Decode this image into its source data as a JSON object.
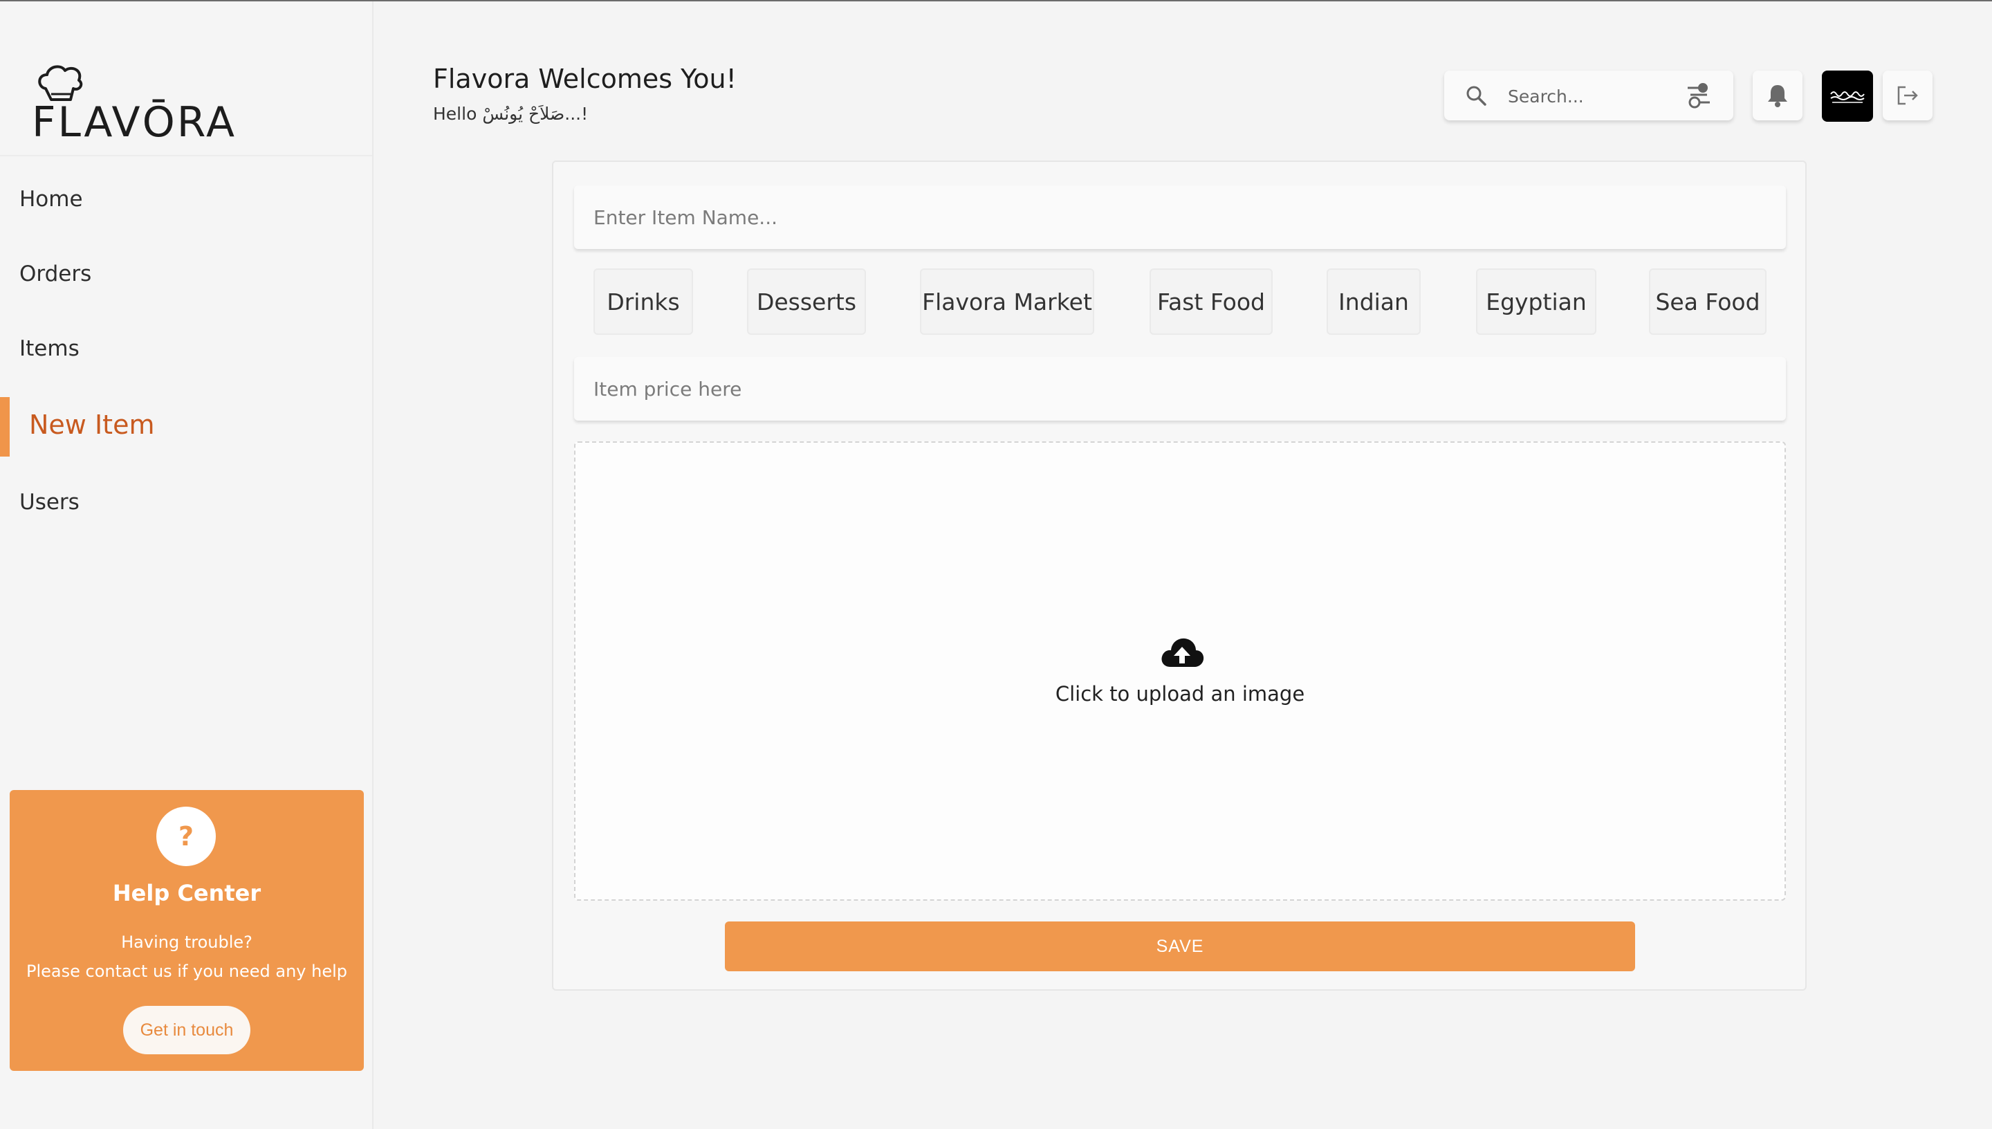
{
  "brand": {
    "logo_text": "FLAVŌRA"
  },
  "header": {
    "title": "Flavora Welcomes You!",
    "subtitle": "Hello صَلاَحْ يُونُسْ...!"
  },
  "search": {
    "placeholder": "Search..."
  },
  "sidebar": {
    "items": [
      {
        "label": "Home",
        "active": false
      },
      {
        "label": "Orders",
        "active": false
      },
      {
        "label": "Items",
        "active": false
      },
      {
        "label": "New Item",
        "active": true
      },
      {
        "label": "Users",
        "active": false
      }
    ]
  },
  "help": {
    "icon": "?",
    "title": "Help Center",
    "line1": "Having trouble?",
    "line2": "Please contact us if you need any help",
    "button": "Get in touch"
  },
  "form": {
    "name_placeholder": "Enter Item Name...",
    "price_placeholder": "Item price here",
    "categories": [
      "Drinks",
      "Desserts",
      "Flavora Market",
      "Fast Food",
      "Indian",
      "Egyptian",
      "Sea Food"
    ],
    "upload_text": "Click to upload an image",
    "save_label": "SAVE"
  },
  "colors": {
    "accent": "#f0984d",
    "active_text": "#c85a1f"
  }
}
